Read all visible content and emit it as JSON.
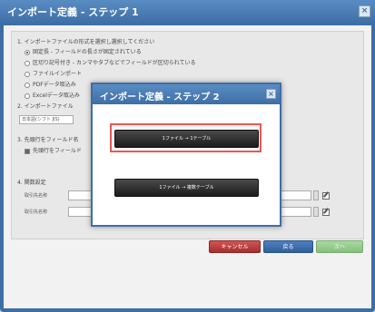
{
  "window": {
    "title": "インポート定義 - ステップ 1",
    "close_glyph": "×"
  },
  "form": {
    "section1_label": "1. インポートファイルの形式を選択し選択してください",
    "option1": "固定長 - フィールドの長さが固定されている",
    "option2": "区切り記号付き - カンマやタブなどでフィールドが区切られている",
    "option3": "ファイルインポート",
    "option4": "PDFデータ取込み",
    "option5": "Excelデータ取込み",
    "section2_label": "2. インポートファイル",
    "encoding_value": "日本語(シフト JIS)",
    "section3_label": "3. 先頭行をフィールド名",
    "checkbox_label": "先頭行をフィールド",
    "section4_label": "4. 関数設定",
    "field_label_1": "取引先名称",
    "field_label_2": "取引先名称"
  },
  "footer": {
    "cancel_label": "キャンセル",
    "back_label": "戻る",
    "next_label": "次へ"
  },
  "modal": {
    "title": "インポート定義 - ステップ 2",
    "close_glyph": "×",
    "choice1_label": "1ファイル → 1テーブル",
    "choice2_label": "1ファイル → 複数テーブル"
  },
  "colors": {
    "titlebar": "#3e6ea6",
    "cancel": "#b73b3b",
    "back": "#3a69a8",
    "next": "#95c98c",
    "highlight": "#e25a5a"
  }
}
